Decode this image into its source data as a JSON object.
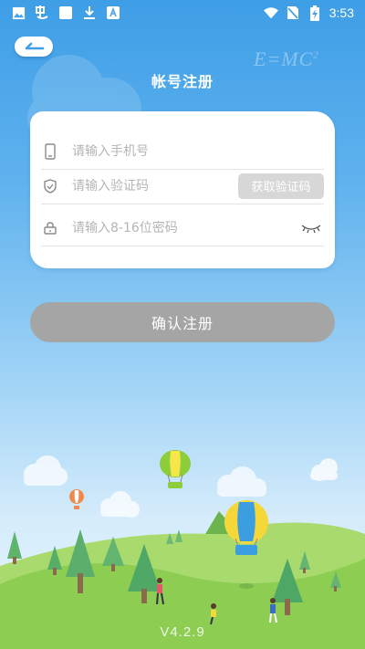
{
  "status_bar": {
    "time": "3:53",
    "left_icons": [
      "image-icon",
      "app-icon",
      "square-icon",
      "download-icon",
      "font-icon"
    ],
    "right_icons": [
      "wifi-icon",
      "no-sim-icon",
      "battery-charging-icon"
    ]
  },
  "header": {
    "title": "帐号注册",
    "decoration_formula": "E=MC",
    "decoration_superscript": "2"
  },
  "form": {
    "phone": {
      "placeholder": "请输入手机号",
      "value": "",
      "icon": "phone-icon"
    },
    "code": {
      "placeholder": "请输入验证码",
      "value": "",
      "icon": "shield-icon",
      "button_label": "获取验证码"
    },
    "password": {
      "placeholder": "请输入8-16位密码",
      "value": "",
      "icon": "lock-icon",
      "toggle_icon": "eye-closed-icon"
    }
  },
  "submit": {
    "label": "确认注册"
  },
  "footer": {
    "version": "V4.2.9"
  },
  "colors": {
    "sky_top": "#3e9ee6",
    "hill": "#8ccd52",
    "tree": "#5fb36a",
    "button_disabled": "#a5a5a5",
    "code_button": "#d7d7d7"
  }
}
